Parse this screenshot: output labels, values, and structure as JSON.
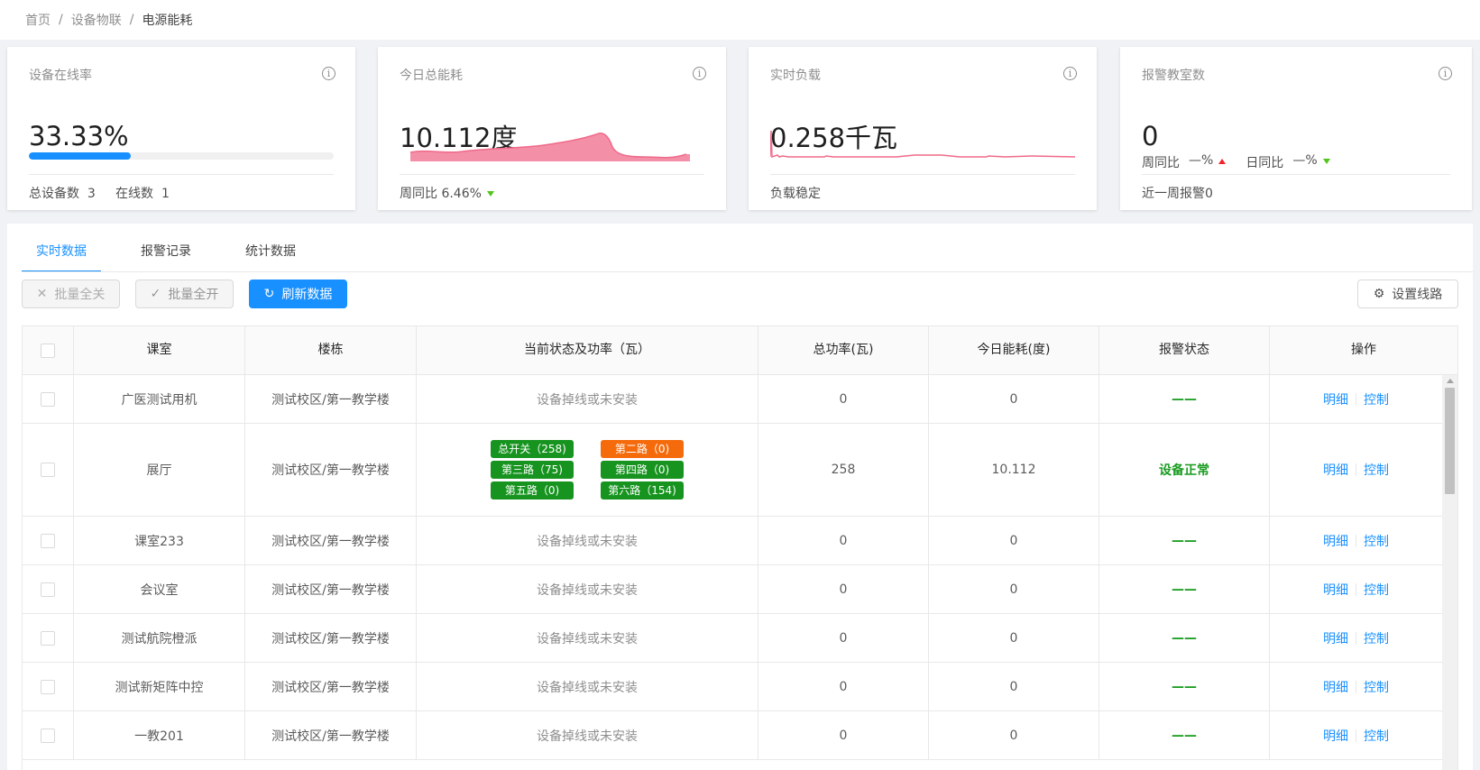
{
  "breadcrumb": [
    "首页",
    "设备物联",
    "电源能耗"
  ],
  "cards": [
    {
      "label": "设备在线率",
      "value": "33.33%",
      "progress_percent": 33.33,
      "footer": "总设备数  3     在线数  1"
    },
    {
      "label": "今日总能耗",
      "value": "10.112度",
      "footer": "周同比  6.46%",
      "trend": "down"
    },
    {
      "label": "实时负载",
      "value": "0.258千瓦",
      "footer": "负载稳定"
    },
    {
      "label": "报警教室数",
      "value": "0",
      "wow_label": "周同比",
      "wow_value": "—%",
      "dod_label": "日同比",
      "dod_value": "—%",
      "footer": "近一周报警0"
    }
  ],
  "tabs": [
    "实时数据",
    "报警记录",
    "统计数据"
  ],
  "toolbar": {
    "batch_off": "批量全关",
    "batch_on": "批量全开",
    "refresh": "刷新数据",
    "settings": "设置线路"
  },
  "table": {
    "headers": [
      "课室",
      "楼栋",
      "当前状态及功率（瓦）",
      "总功率(瓦)",
      "今日能耗(度)",
      "报警状态",
      "操作"
    ],
    "ops": {
      "detail": "明细",
      "control": "控制"
    },
    "rows": [
      {
        "room": "广医测试用机",
        "building": "测试校区/第一教学楼",
        "status": "设备掉线或未安装",
        "total_power": "0",
        "energy": "0",
        "alarm": "——"
      },
      {
        "room": "展厅",
        "building": "测试校区/第一教学楼",
        "status": "",
        "total_power": "258",
        "energy": "10.112",
        "alarm": "设备正常"
      },
      {
        "room": "课室233",
        "building": "测试校区/第一教学楼",
        "status": "设备掉线或未安装",
        "total_power": "0",
        "energy": "0",
        "alarm": "——"
      },
      {
        "room": "会议室",
        "building": "测试校区/第一教学楼",
        "status": "设备掉线或未安装",
        "total_power": "0",
        "energy": "0",
        "alarm": "——"
      },
      {
        "room": "测试航院橙派",
        "building": "测试校区/第一教学楼",
        "status": "设备掉线或未安装",
        "total_power": "0",
        "energy": "0",
        "alarm": "——"
      },
      {
        "room": "测试新矩阵中控",
        "building": "测试校区/第一教学楼",
        "status": "设备掉线或未安装",
        "total_power": "0",
        "energy": "0",
        "alarm": "——"
      },
      {
        "room": "一教201",
        "building": "测试校区/第一教学楼",
        "status": "设备掉线或未安装",
        "total_power": "0",
        "energy": "0",
        "alarm": "——"
      }
    ],
    "circuits": [
      {
        "label": "总开关（258)",
        "state": "on"
      },
      {
        "label": "第二路（0)",
        "state": "off"
      },
      {
        "label": "第三路（75)",
        "state": "on"
      },
      {
        "label": "第四路（0)",
        "state": "on"
      },
      {
        "label": "第五路（0)",
        "state": "on"
      },
      {
        "label": "第六路（154)",
        "state": "on"
      }
    ]
  },
  "colors": {
    "primary": "#1890ff",
    "ok": "#1a9c20",
    "chip_on": "#17941f",
    "chip_off": "#f56b0c",
    "spark": "#f06a8a"
  }
}
